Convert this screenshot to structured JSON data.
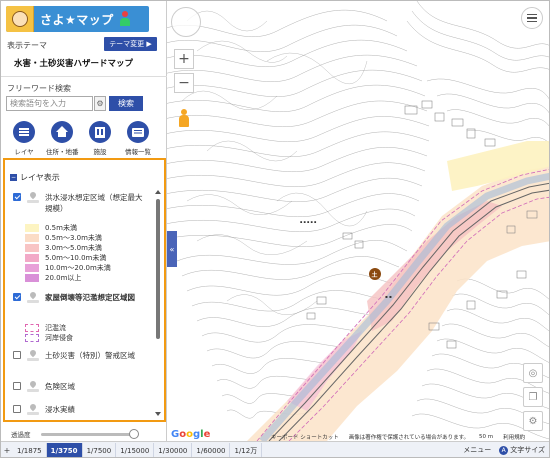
{
  "app": {
    "logo_text": "さよ★マップ",
    "theme_label": "表示テーマ",
    "theme_change_button": "テーマ変更 ▶",
    "theme_name": "水害・土砂災害ハザードマップ"
  },
  "search": {
    "label": "フリーワード検索",
    "placeholder": "検索語句を入力",
    "button": "検索"
  },
  "nav": [
    {
      "label": "レイヤ",
      "icon": "list-icon"
    },
    {
      "label": "住所・地番",
      "icon": "house-icon"
    },
    {
      "label": "施設",
      "icon": "building-icon"
    },
    {
      "label": "情報一覧",
      "icon": "document-icon"
    }
  ],
  "layer_panel": {
    "title": "レイヤ表示",
    "layers": [
      {
        "name": "洪水浸水想定区域（想定最大規模）",
        "checked": true,
        "bold": false
      },
      {
        "name": "家屋倒壊等氾濫想定区域図",
        "checked": true,
        "bold": true
      },
      {
        "name": "土砂災害（特別）警戒区域",
        "checked": false,
        "bold": false
      },
      {
        "name": "危険区域",
        "checked": false,
        "bold": false
      },
      {
        "name": "浸水実績",
        "checked": false,
        "bold": false
      }
    ],
    "flood_legend": [
      {
        "label": "0.5m未満",
        "color": "#fdf4c2"
      },
      {
        "label": "0.5m〜3.0m未満",
        "color": "#fbdcc6"
      },
      {
        "label": "3.0m〜5.0m未満",
        "color": "#f8c4c4"
      },
      {
        "label": "5.0m〜10.0m未満",
        "color": "#f2a9c7"
      },
      {
        "label": "10.0m〜20.0m未満",
        "color": "#e8a0d8"
      },
      {
        "label": "20.0m以上",
        "color": "#d990d8"
      }
    ],
    "house_legend": [
      {
        "label": "氾濫流",
        "color": "#e066b0"
      },
      {
        "label": "河岸侵食",
        "color": "#b06ad0"
      }
    ]
  },
  "opacity_label": "透過度",
  "map": {
    "collapse_arrow": "«",
    "zoom_in": "+",
    "zoom_out": "−",
    "marker_symbol": "土",
    "label_1": "佐用町役場",
    "label_2": "中町",
    "footer": {
      "keyboard": "キーボード ショートカット",
      "copyright": "画像は著作権で保護されている場合があります。",
      "scale": "50 m",
      "terms": "利用規約"
    }
  },
  "scales": [
    "1/1875",
    "1/3750",
    "1/7500",
    "1/15000",
    "1/30000",
    "1/60000",
    "1/12万"
  ],
  "active_scale": "1/3750",
  "bottom_right": {
    "menu": "メニュー",
    "text_size": "文字サイズ"
  }
}
